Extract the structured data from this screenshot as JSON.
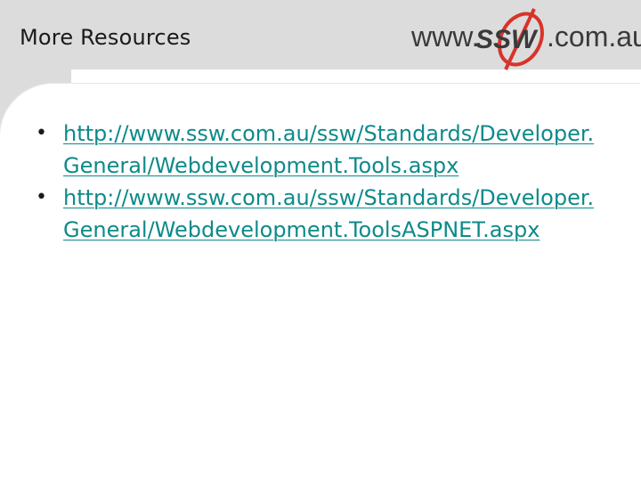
{
  "slide": {
    "title": "More Resources",
    "logo": {
      "prefix": "www.",
      "brand": "SSW",
      "suffix": ".com.au",
      "icon": "ssw-logo-icon"
    },
    "bullets": [
      {
        "text": "http://www.ssw.com.au/ssw/Standards/Developer.General/Webdevelopment.Tools.aspx"
      },
      {
        "text": "http://www.ssw.com.au/ssw/Standards/Developer.General/Webdevelopment.ToolsASPNET.aspx"
      }
    ]
  },
  "colors": {
    "header_bg": "#dcdcdc",
    "link": "#0e8a8a",
    "logo_red": "#d8332a",
    "logo_dark": "#3a3a3a"
  }
}
